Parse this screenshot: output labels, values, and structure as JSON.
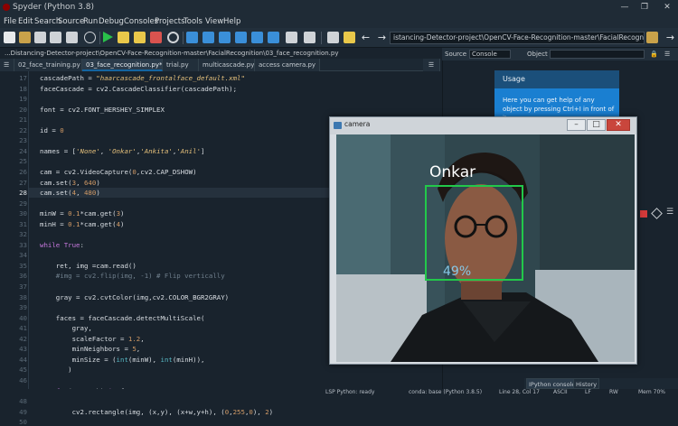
{
  "window": {
    "title": "Spyder (Python 3.8)",
    "controls": [
      "—",
      "❐",
      "✕"
    ]
  },
  "menu": [
    "File",
    "Edit",
    "Search",
    "Source",
    "Run",
    "Debug",
    "Consoles",
    "Projects",
    "Tools",
    "View",
    "Help"
  ],
  "toolbar": {
    "path_value": "istancing-Detector-project\\OpenCV-Face-Recognition-master\\FacialRecognition"
  },
  "breadcrumb": "...Distancing-Detector-project\\OpenCV-Face-Recognition-master\\FacialRecognition\\03_face_recognition.py",
  "tabs": [
    "02_face_training.py",
    "03_face_recognition.py*",
    "trial.py",
    "multicascade.py",
    "access camera.py"
  ],
  "editor": {
    "current_line": 28,
    "lines": [
      {
        "n": "17",
        "segs": [
          {
            "t": "cascadePath = ",
            "c": ""
          },
          {
            "t": "\"haarcascade_frontalface_default.xml\"",
            "c": "str"
          }
        ]
      },
      {
        "n": "18",
        "segs": [
          {
            "t": "faceCascade = cv2.CascadeClassifier(cascadePath);",
            "c": ""
          }
        ]
      },
      {
        "n": "19",
        "segs": []
      },
      {
        "n": "20",
        "segs": [
          {
            "t": "font = cv2.FONT_HERSHEY_SIMPLEX",
            "c": ""
          }
        ]
      },
      {
        "n": "21",
        "segs": []
      },
      {
        "n": "22",
        "segs": [
          {
            "t": "id = ",
            "c": ""
          },
          {
            "t": "0",
            "c": "num"
          }
        ]
      },
      {
        "n": "23",
        "segs": []
      },
      {
        "n": "24",
        "segs": [
          {
            "t": "names = [",
            "c": ""
          },
          {
            "t": "'None'",
            "c": "str"
          },
          {
            "t": ", ",
            "c": ""
          },
          {
            "t": "'Onkar'",
            "c": "str"
          },
          {
            "t": ",",
            "c": ""
          },
          {
            "t": "'Ankita'",
            "c": "str"
          },
          {
            "t": ",",
            "c": ""
          },
          {
            "t": "'Anil'",
            "c": "str"
          },
          {
            "t": "]",
            "c": ""
          }
        ]
      },
      {
        "n": "25",
        "segs": []
      },
      {
        "n": "26",
        "segs": [
          {
            "t": "cam = cv2.VideoCapture(",
            "c": ""
          },
          {
            "t": "0",
            "c": "num"
          },
          {
            "t": ",cv2.CAP_DSHOW)",
            "c": ""
          }
        ]
      },
      {
        "n": "27",
        "segs": [
          {
            "t": "cam.set(",
            "c": ""
          },
          {
            "t": "3",
            "c": "num"
          },
          {
            "t": ", ",
            "c": ""
          },
          {
            "t": "640",
            "c": "num"
          },
          {
            "t": ")",
            "c": ""
          }
        ]
      },
      {
        "n": "28",
        "segs": [
          {
            "t": "cam.set(",
            "c": ""
          },
          {
            "t": "4",
            "c": "num"
          },
          {
            "t": ", ",
            "c": ""
          },
          {
            "t": "480",
            "c": "num"
          },
          {
            "t": ")",
            "c": ""
          }
        ]
      },
      {
        "n": "29",
        "segs": []
      },
      {
        "n": "30",
        "segs": [
          {
            "t": "minW = ",
            "c": ""
          },
          {
            "t": "0.1",
            "c": "num"
          },
          {
            "t": "*cam.get(",
            "c": ""
          },
          {
            "t": "3",
            "c": "num"
          },
          {
            "t": ")",
            "c": ""
          }
        ]
      },
      {
        "n": "31",
        "segs": [
          {
            "t": "minH = ",
            "c": ""
          },
          {
            "t": "0.1",
            "c": "num"
          },
          {
            "t": "*cam.get(",
            "c": ""
          },
          {
            "t": "4",
            "c": "num"
          },
          {
            "t": ")",
            "c": ""
          }
        ]
      },
      {
        "n": "32",
        "segs": []
      },
      {
        "n": "33",
        "segs": [
          {
            "t": "while ",
            "c": "kw"
          },
          {
            "t": "True",
            "c": "kw"
          },
          {
            "t": ":",
            "c": ""
          }
        ]
      },
      {
        "n": "34",
        "segs": []
      },
      {
        "n": "35",
        "segs": [
          {
            "t": "    ret, img =cam.read()",
            "c": ""
          }
        ]
      },
      {
        "n": "36",
        "segs": [
          {
            "t": "    #img = cv2.flip(img, -1) # Flip vertically",
            "c": "cmt"
          }
        ]
      },
      {
        "n": "37",
        "segs": []
      },
      {
        "n": "38",
        "segs": [
          {
            "t": "    gray = cv2.cvtColor(img,cv2.COLOR_BGR2GRAY)",
            "c": ""
          }
        ]
      },
      {
        "n": "39",
        "segs": []
      },
      {
        "n": "40",
        "segs": [
          {
            "t": "    faces = faceCascade.detectMultiScale(",
            "c": ""
          }
        ]
      },
      {
        "n": "41",
        "segs": [
          {
            "t": "        gray,",
            "c": ""
          }
        ]
      },
      {
        "n": "42",
        "segs": [
          {
            "t": "        scaleFactor = ",
            "c": ""
          },
          {
            "t": "1.2",
            "c": "num"
          },
          {
            "t": ",",
            "c": ""
          }
        ]
      },
      {
        "n": "43",
        "segs": [
          {
            "t": "        minNeighbors = ",
            "c": ""
          },
          {
            "t": "5",
            "c": "num"
          },
          {
            "t": ",",
            "c": ""
          }
        ]
      },
      {
        "n": "44",
        "segs": [
          {
            "t": "        minSize = (",
            "c": ""
          },
          {
            "t": "int",
            "c": "bi"
          },
          {
            "t": "(minW), ",
            "c": ""
          },
          {
            "t": "int",
            "c": "bi"
          },
          {
            "t": "(minH)),",
            "c": ""
          }
        ]
      },
      {
        "n": "45",
        "segs": [
          {
            "t": "       )",
            "c": ""
          }
        ]
      },
      {
        "n": "46",
        "segs": []
      },
      {
        "n": "47",
        "segs": [
          {
            "t": "    ",
            "c": ""
          },
          {
            "t": "for",
            "c": "kw"
          },
          {
            "t": "(x,y,w,h) ",
            "c": ""
          },
          {
            "t": "in",
            "c": "kw"
          },
          {
            "t": " faces:",
            "c": ""
          }
        ]
      },
      {
        "n": "48",
        "segs": []
      },
      {
        "n": "49",
        "segs": [
          {
            "t": "        cv2.rectangle(img, (x,y), (x+w,y+h), (",
            "c": ""
          },
          {
            "t": "0",
            "c": "num"
          },
          {
            "t": ",",
            "c": ""
          },
          {
            "t": "255",
            "c": "num"
          },
          {
            "t": ",",
            "c": ""
          },
          {
            "t": "0",
            "c": "num"
          },
          {
            "t": "), ",
            "c": ""
          },
          {
            "t": "2",
            "c": "num"
          },
          {
            "t": ")",
            "c": ""
          }
        ]
      },
      {
        "n": "50",
        "segs": []
      }
    ]
  },
  "help": {
    "source_label": "Source",
    "source_value": "Console",
    "object_label": "Object",
    "usage_title": "Usage",
    "usage_body": "Here you can get help of any object by pressing Ctrl+I in front of it,"
  },
  "camera": {
    "title": "camera",
    "name_label": "Onkar",
    "confidence_label": "49%"
  },
  "console_tabs": [
    "IPython console",
    "History"
  ],
  "statusbar": [
    "LSP Python: ready",
    "conda: base (Python 3.8.5)",
    "Line 28, Col 17",
    "ASCII",
    "LF",
    "RW",
    "Mem 70%"
  ],
  "colors": {
    "accent": "#1464a0",
    "face_box": "#22c84a",
    "usage_bg": "#1a7fd1"
  }
}
